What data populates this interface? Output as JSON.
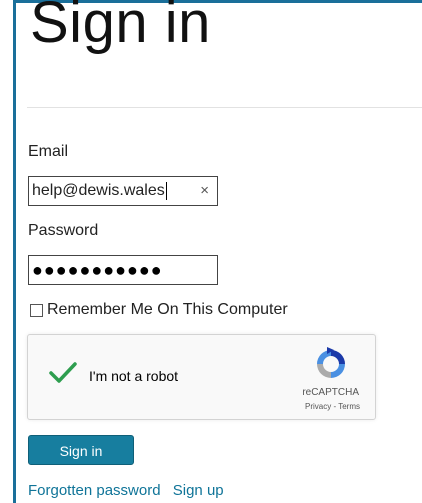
{
  "page": {
    "title": "Sign in"
  },
  "form": {
    "email_label": "Email",
    "email_value": "help@dewis.wales",
    "clear_symbol": "×",
    "password_label": "Password",
    "password_masked": "●●●●●●●●●●●",
    "remember_label": "Remember Me On This Computer",
    "remember_checked": false
  },
  "recaptcha": {
    "label": "I'm not a robot",
    "verified": true,
    "brand": "reCAPTCHA",
    "links": "Privacy - Terms",
    "check_color": "#2e9e4f"
  },
  "actions": {
    "signin_label": "Sign in",
    "forgot_label": "Forgotten password",
    "signup_label": "Sign up"
  },
  "colors": {
    "accent": "#177e9f",
    "border": "#1a6f9a",
    "link": "#0f7498"
  },
  "icons": [
    "clear-icon",
    "check-icon",
    "recaptcha-logo-icon"
  ]
}
